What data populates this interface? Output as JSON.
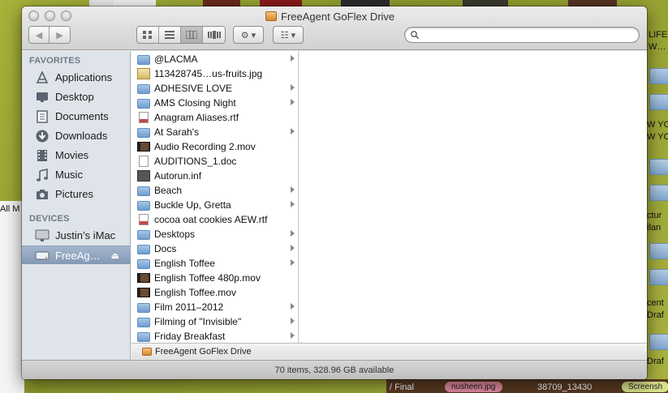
{
  "window": {
    "title": "FreeAgent GoFlex Drive",
    "status": "70 items, 328.96 GB available",
    "path": "FreeAgent GoFlex Drive"
  },
  "toolbar": {
    "back_glyph": "◀",
    "forward_glyph": "▶",
    "view_icons": [
      "icon-view-icon",
      "list-view-icon",
      "column-view-icon",
      "coverflow-view-icon"
    ],
    "active_view": "column-view-icon",
    "action_glyph": "⚙ ▾",
    "arrange_glyph": "☷ ▾",
    "search_placeholder": ""
  },
  "sidebar": {
    "favorites_heading": "FAVORITES",
    "favorites": [
      {
        "label": "Applications",
        "icon": "applications-icon"
      },
      {
        "label": "Desktop",
        "icon": "desktop-icon"
      },
      {
        "label": "Documents",
        "icon": "documents-icon"
      },
      {
        "label": "Downloads",
        "icon": "downloads-icon"
      },
      {
        "label": "Movies",
        "icon": "movies-icon"
      },
      {
        "label": "Music",
        "icon": "music-icon"
      },
      {
        "label": "Pictures",
        "icon": "pictures-icon"
      }
    ],
    "devices_heading": "DEVICES",
    "devices": [
      {
        "label": "Justin’s iMac",
        "icon": "imac-icon"
      },
      {
        "label": "FreeAg…",
        "icon": "external-drive-icon",
        "selected": true,
        "eject": "⏏"
      }
    ]
  },
  "files": [
    {
      "name": "@LACMA",
      "kind": "folder",
      "arrow": true
    },
    {
      "name": "113428745…us-fruits.jpg",
      "kind": "img",
      "arrow": false
    },
    {
      "name": "ADHESIVE LOVE",
      "kind": "folder",
      "arrow": true
    },
    {
      "name": "AMS Closing Night",
      "kind": "folder",
      "arrow": true
    },
    {
      "name": "Anagram Aliases.rtf",
      "kind": "rtf",
      "arrow": false
    },
    {
      "name": "At Sarah's",
      "kind": "folder",
      "arrow": true
    },
    {
      "name": "Audio Recording 2.mov",
      "kind": "mov",
      "arrow": false
    },
    {
      "name": "AUDITIONS_1.doc",
      "kind": "doc",
      "arrow": false
    },
    {
      "name": "Autorun.inf",
      "kind": "inf",
      "arrow": false
    },
    {
      "name": "Beach",
      "kind": "folder",
      "arrow": true
    },
    {
      "name": "Buckle Up, Gretta",
      "kind": "folder",
      "arrow": true
    },
    {
      "name": "cocoa oat cookies AEW.rtf",
      "kind": "rtf",
      "arrow": false
    },
    {
      "name": "Desktops",
      "kind": "folder",
      "arrow": true
    },
    {
      "name": "Docs",
      "kind": "folder",
      "arrow": true
    },
    {
      "name": "English Toffee",
      "kind": "folder",
      "arrow": true
    },
    {
      "name": "English Toffee 480p.mov",
      "kind": "mov",
      "arrow": false
    },
    {
      "name": "English Toffee.mov",
      "kind": "mov",
      "arrow": false
    },
    {
      "name": "Film 2011–2012",
      "kind": "folder",
      "arrow": true
    },
    {
      "name": "Filming of \"Invisible\"",
      "kind": "folder",
      "arrow": true
    },
    {
      "name": "Friday Breakfast",
      "kind": "folder",
      "arrow": true
    }
  ],
  "background": {
    "left_text": "All M",
    "right_texts": [
      "LIFE",
      "W…",
      "W YO",
      "W YO",
      "ctur",
      "ilan",
      "cent",
      "Draf",
      "Draf"
    ],
    "bottom_texts": [
      "/ Final",
      "nusheen.jpg",
      "38709_13430",
      "Screensh"
    ]
  },
  "colors": {
    "sidebar_bg": "#dfe4ea",
    "selection": "#8599b4",
    "desktop": "#a7b23a"
  }
}
